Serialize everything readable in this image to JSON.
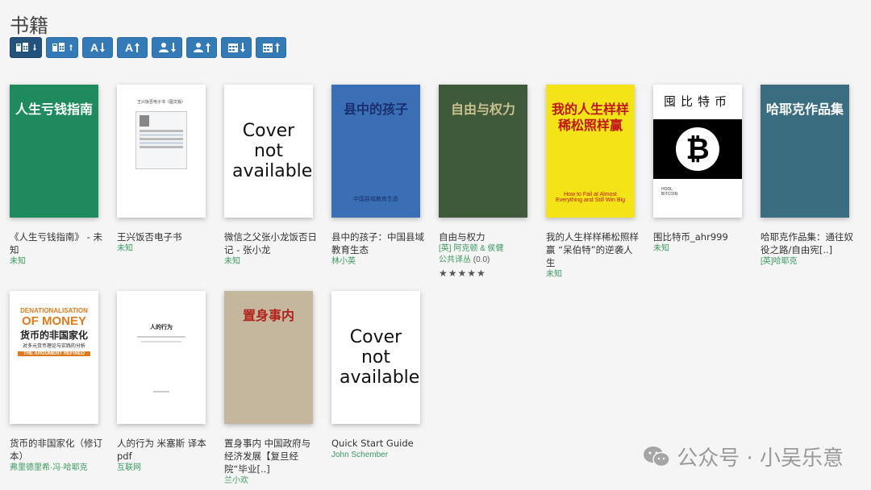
{
  "page": {
    "title": "书籍"
  },
  "toolbar": {
    "buttons": [
      {
        "name": "sort-date-desc-button",
        "kind": "book-date",
        "arrow": "down",
        "active": true
      },
      {
        "name": "sort-date-asc-button",
        "kind": "book-date",
        "arrow": "up",
        "active": false
      },
      {
        "name": "sort-title-asc-button",
        "kind": "title",
        "label": "A",
        "arrow": "down",
        "active": false
      },
      {
        "name": "sort-title-desc-button",
        "kind": "title",
        "label": "A",
        "arrow": "up",
        "active": false
      },
      {
        "name": "sort-author-asc-button",
        "kind": "author",
        "arrow": "down",
        "active": false
      },
      {
        "name": "sort-author-desc-button",
        "kind": "author",
        "arrow": "up",
        "active": false
      },
      {
        "name": "sort-pubdate-desc-button",
        "kind": "calendar",
        "arrow": "down",
        "active": false
      },
      {
        "name": "sort-pubdate-asc-button",
        "kind": "calendar",
        "arrow": "up",
        "active": false
      }
    ]
  },
  "books": [
    {
      "title": "《人生亏钱指南》 - 未知",
      "author": "未知",
      "cover": {
        "type": "art",
        "bg": "#1e8a5e",
        "big": "人生亏钱指南",
        "color": "#fff"
      }
    },
    {
      "title": "王兴饭否电子书",
      "author": "未知",
      "cover": {
        "type": "doc",
        "small": "王兴饭否电子书（图文版）"
      }
    },
    {
      "title": "微信之父张小龙饭否日记 - 张小龙",
      "author": "未知",
      "cover": {
        "type": "na",
        "text": "Cover not available"
      }
    },
    {
      "title": "县中的孩子：中国县域教育生态",
      "author": "林小英",
      "cover": {
        "type": "art",
        "bg": "#3a6fb5",
        "big": "县中的孩子",
        "small": "中国县域教育生态",
        "color": "#1b2f6e"
      }
    },
    {
      "title": "自由与权力",
      "author": "[英] 阿克顿 & 侯健",
      "series": "公共译丛",
      "series_num": "(0.0)",
      "rating": "★★★★★",
      "cover": {
        "type": "art",
        "bg": "#3e5a3a",
        "big": "自由与权力",
        "color": "#c9c08f"
      }
    },
    {
      "title": "我的人生样样稀松照样赢 “呆伯特”的逆袭人生",
      "author": "未知",
      "cover": {
        "type": "art",
        "bg": "#f3e317",
        "big": "我的人生样样稀松照样赢",
        "small": "How to Fail at Almost Everything and Still Win Big",
        "color": "#c01818"
      }
    },
    {
      "title": "围比特币_ahr999",
      "author": "未知",
      "cover": {
        "type": "btc",
        "big": "囤比特币",
        "icon": "bitcoin-icon",
        "small": "HODL BITCOIN"
      }
    },
    {
      "title": "哈耶克作品集：通往奴役之路/自由宪[..]",
      "author": "[英]哈耶克",
      "cover": {
        "type": "art",
        "bg": "#3b6d80",
        "big": "哈耶克作品集",
        "color": "#fff"
      }
    },
    {
      "title": "货币的非国家化（修订本）",
      "author": "弗里德里希·冯·哈耶克",
      "cover": {
        "type": "money",
        "small": "DENATIONALISATION",
        "big": "OF MONEY",
        "cn": "货币的非国家化",
        "sub": "对多元货币理论与实践的分析",
        "refined": "THE ARGUMENT REFINED"
      }
    },
    {
      "title": "人的行为 米塞斯 译本 pdf",
      "author": "互联网",
      "cover": {
        "type": "doc2",
        "small": "人的行为"
      }
    },
    {
      "title": "置身事内 中国政府与经济发展【复旦经院“毕业[..]",
      "author": "兰小欢",
      "cover": {
        "type": "art",
        "bg": "#c4b79e",
        "big": "置身事内",
        "color": "#b2241b"
      }
    },
    {
      "title": "Quick Start Guide",
      "author": "John Schember",
      "cover": {
        "type": "na",
        "text": "Cover not available"
      }
    }
  ],
  "watermark": {
    "text": "公众号 · 小吴乐意"
  }
}
